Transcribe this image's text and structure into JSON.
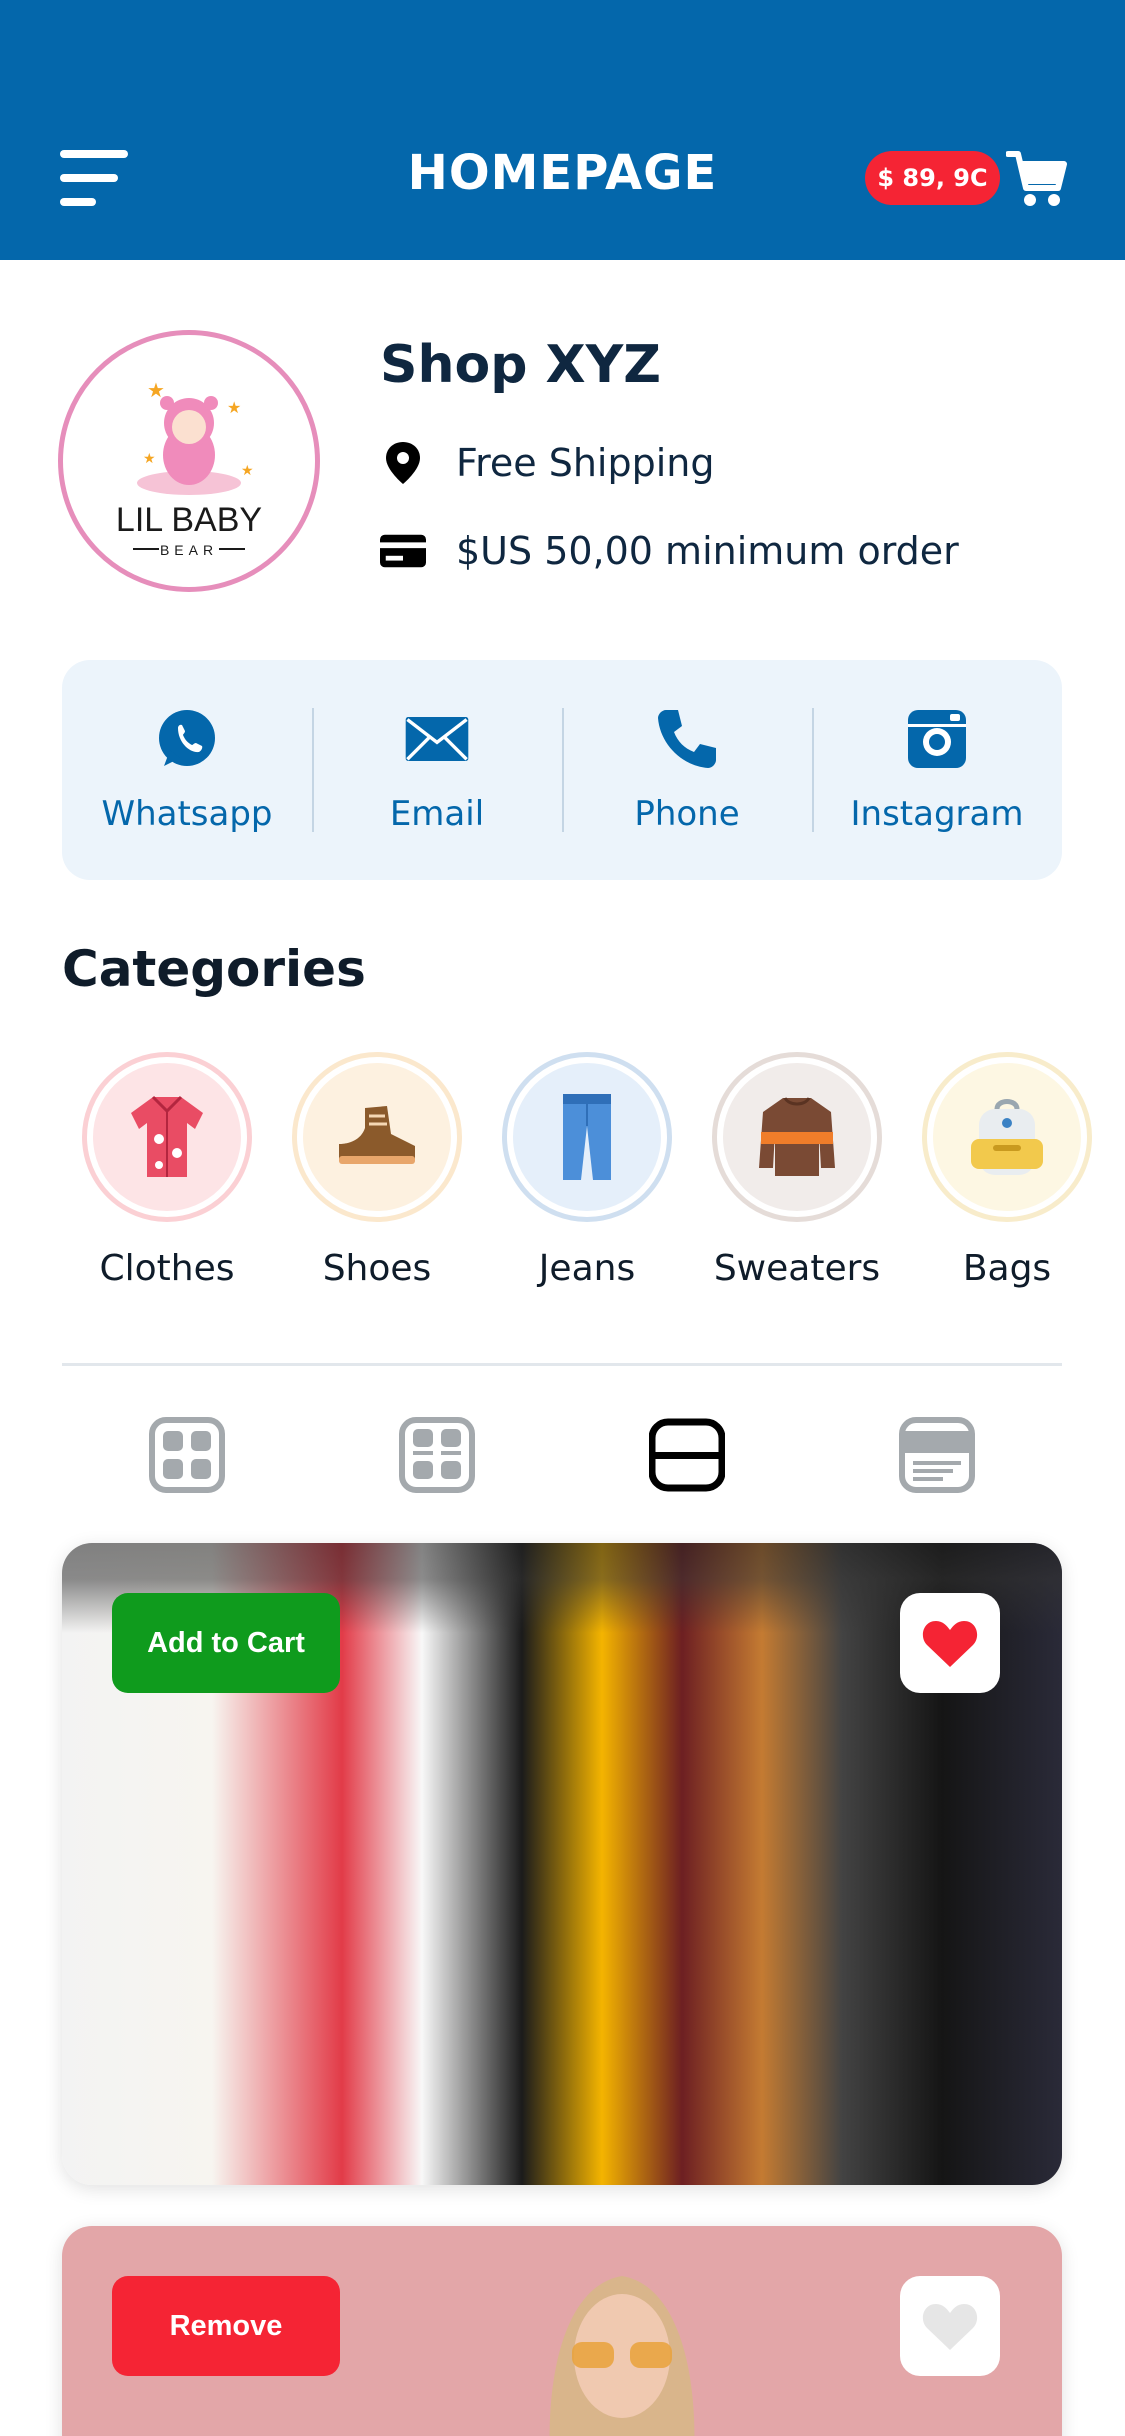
{
  "header": {
    "title": "HOMEPAGE",
    "cart_total": "$ 89, 9C",
    "menu_icon": "hamburger-menu-icon",
    "cart_icon": "shopping-cart-icon",
    "background": "#0467ab"
  },
  "shop": {
    "name": "Shop XYZ",
    "logo_text": "LIL BABY",
    "logo_subtext": "BEAR",
    "shipping": "Free Shipping",
    "minimum_order": "$US 50,00 minimum order"
  },
  "contacts": [
    {
      "label": "Whatsapp",
      "icon": "whatsapp-icon"
    },
    {
      "label": "Email",
      "icon": "email-icon"
    },
    {
      "label": "Phone",
      "icon": "phone-icon"
    },
    {
      "label": "Instagram",
      "icon": "instagram-icon"
    }
  ],
  "categories": {
    "title": "Categories",
    "items": [
      {
        "label": "Clothes",
        "icon": "clothes-icon",
        "color": "#fde4e6"
      },
      {
        "label": "Shoes",
        "icon": "shoes-icon",
        "color": "#fdf1e0"
      },
      {
        "label": "Jeans",
        "icon": "jeans-icon",
        "color": "#e5effa"
      },
      {
        "label": "Sweaters",
        "icon": "sweater-icon",
        "color": "#f1ecea"
      },
      {
        "label": "Bags",
        "icon": "bag-icon",
        "color": "#fdf7e3"
      }
    ]
  },
  "views": {
    "options": [
      "grid-2x2",
      "grid-cards",
      "list-large",
      "list-detail"
    ],
    "selected": "list-large"
  },
  "products": [
    {
      "action": "Add to Cart",
      "favorite": true
    },
    {
      "action": "Remove",
      "favorite": false
    }
  ]
}
